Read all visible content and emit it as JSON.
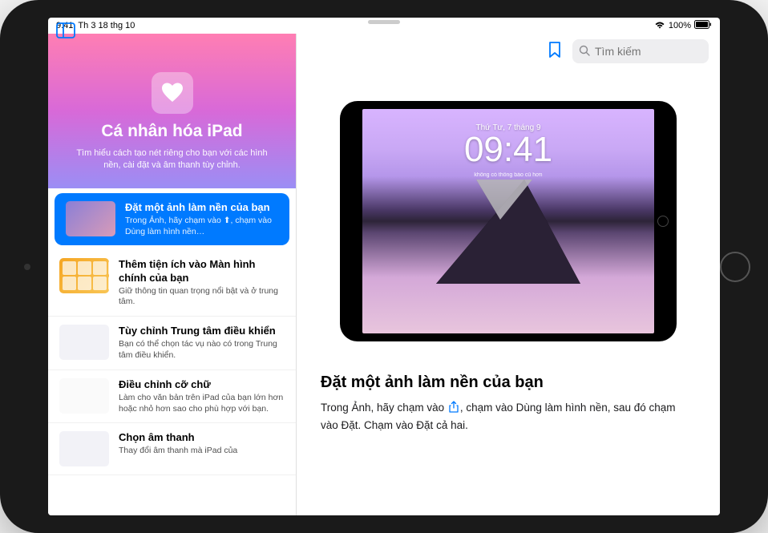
{
  "status": {
    "time": "9:41",
    "date": "Th 3 18 thg 10",
    "battery": "100%"
  },
  "sidebar": {
    "title": "Cá nhân hóa iPad",
    "subtitle": "Tìm hiểu cách tạo nét riêng cho bạn với các hình nền, cài đặt và âm thanh tùy chỉnh.",
    "items": [
      {
        "title": "Đặt một ảnh làm nền của bạn",
        "desc": "Trong Ảnh, hãy chạm vào ⬆, chạm vào Dùng làm hình nền…",
        "selected": true,
        "thumb": "thumb-bg1"
      },
      {
        "title": "Thêm tiện ích vào Màn hình chính của bạn",
        "desc": "Giữ thông tin quan trọng nổi bật và ở trung tâm.",
        "selected": false,
        "thumb": "thumb-bg2"
      },
      {
        "title": "Tùy chỉnh Trung tâm điều khiển",
        "desc": "Bạn có thể chọn tác vụ nào có trong Trung tâm điều khiển.",
        "selected": false,
        "thumb": "thumb-bg3"
      },
      {
        "title": "Điều chỉnh cỡ chữ",
        "desc": "Làm cho văn bản trên iPad của bạn lớn hơn hoặc nhỏ hơn sao cho phù hợp với bạn.",
        "selected": false,
        "thumb": "thumb-bg4"
      },
      {
        "title": "Chọn âm thanh",
        "desc": "Thay đổi âm thanh mà iPad của",
        "selected": false,
        "thumb": "thumb-bg5"
      }
    ]
  },
  "search": {
    "placeholder": "Tìm kiếm"
  },
  "lockscreen": {
    "date": "Thứ Tư, 7 tháng 9",
    "time": "09:41",
    "sub": "không có thông báo cũ hơn"
  },
  "article": {
    "title": "Đặt một ảnh làm nền của bạn",
    "pre": "Trong Ảnh, hãy chạm vào",
    "mid": ", chạm vào Dùng làm hình nền, sau đó chạm vào Đặt. Chạm vào Đặt cả hai."
  }
}
